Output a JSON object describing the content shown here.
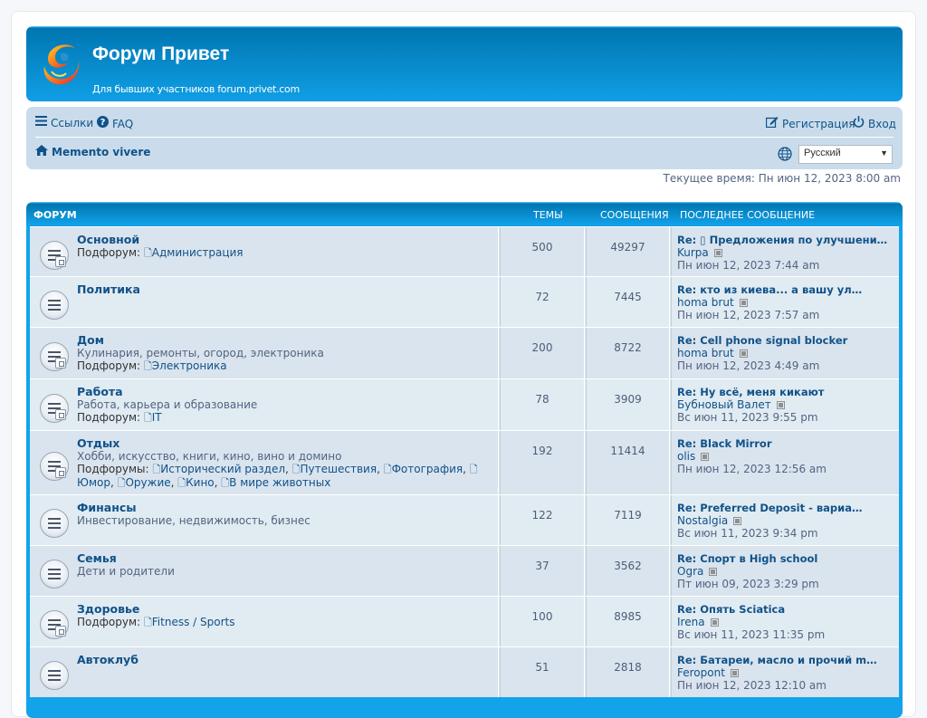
{
  "header": {
    "site_title": "Форум Привет",
    "site_description": "Для бывших участников forum.privet.com"
  },
  "navbar": {
    "links_label": "Ссылки",
    "faq_label": "FAQ",
    "register_label": "Регистрация",
    "login_label": "Вход",
    "breadcrumb_label": "Memento vivere",
    "language_selected": "Русский"
  },
  "current_time": "Текущее время: Пн июн 12, 2023 8:00 am",
  "table": {
    "col_forum": "ФОРУМ",
    "col_topics": "ТЕМЫ",
    "col_posts": "СООБЩЕНИЯ",
    "col_last": "ПОСЛЕДНЕЕ СООБЩЕНИЕ"
  },
  "forums": [
    {
      "title": "Основной",
      "description": "",
      "subforums_label": "Подфорум:",
      "subforums": [
        "Администрация"
      ],
      "topics": "500",
      "posts": "49297",
      "last_title": "Re: ▯ Предложения по улучшени…",
      "last_author": "Kurpa",
      "last_date": "Пн июн 12, 2023 7:44 am"
    },
    {
      "title": "Политика",
      "description": "",
      "subforums_label": "",
      "subforums": [],
      "topics": "72",
      "posts": "7445",
      "last_title": "Re: кто из киева... а вашу ул…",
      "last_author": "homa brut",
      "last_date": "Пн июн 12, 2023 7:57 am"
    },
    {
      "title": "Дом",
      "description": "Кулинария, ремонты, огород, электроника",
      "subforums_label": "Подфорум:",
      "subforums": [
        "Электроника"
      ],
      "topics": "200",
      "posts": "8722",
      "last_title": "Re: Cell phone signal blocker",
      "last_author": "homa brut",
      "last_date": "Пн июн 12, 2023 4:49 am"
    },
    {
      "title": "Работа",
      "description": "Работа, карьера и образование",
      "subforums_label": "Подфорум:",
      "subforums": [
        "IT"
      ],
      "topics": "78",
      "posts": "3909",
      "last_title": "Re: Ну всё, меня кикают",
      "last_author": "Бубновый Валет",
      "last_date": "Вс июн 11, 2023 9:55 pm"
    },
    {
      "title": "Отдых",
      "description": "Хобби, искусство, книги, кино, вино и домино",
      "subforums_label": "Подфорумы:",
      "subforums": [
        "Исторический раздел",
        "Путешествия",
        "Фотография",
        "Юмор",
        "Оружие",
        "Кино",
        "В мире животных"
      ],
      "topics": "192",
      "posts": "11414",
      "last_title": "Re: Black Mirror",
      "last_author": "olis",
      "last_date": "Пн июн 12, 2023 12:56 am"
    },
    {
      "title": "Финансы",
      "description": "Инвестирование, недвижимость, бизнес",
      "subforums_label": "",
      "subforums": [],
      "topics": "122",
      "posts": "7119",
      "last_title": "Re: Preferred Deposit - вариа…",
      "last_author": "Nostalgia",
      "last_date": "Вс июн 11, 2023 9:34 pm"
    },
    {
      "title": "Семья",
      "description": "Дети и родители",
      "subforums_label": "",
      "subforums": [],
      "topics": "37",
      "posts": "3562",
      "last_title": "Re: Спорт в High school",
      "last_author": "Ogra",
      "last_date": "Пт июн 09, 2023 3:29 pm"
    },
    {
      "title": "Здоровье",
      "description": "",
      "subforums_label": "Подфорум:",
      "subforums": [
        "Fitness / Sports"
      ],
      "topics": "100",
      "posts": "8985",
      "last_title": "Re: Опять Sciatica",
      "last_author": "Irena",
      "last_date": "Вс июн 11, 2023 11:35 pm"
    },
    {
      "title": "Автоклуб",
      "description": "",
      "subforums_label": "",
      "subforums": [],
      "topics": "51",
      "posts": "2818",
      "last_title": "Re: Батареи, масло и прочий m…",
      "last_author": "Feropont",
      "last_date": "Пн июн 12, 2023 12:10 am"
    }
  ]
}
